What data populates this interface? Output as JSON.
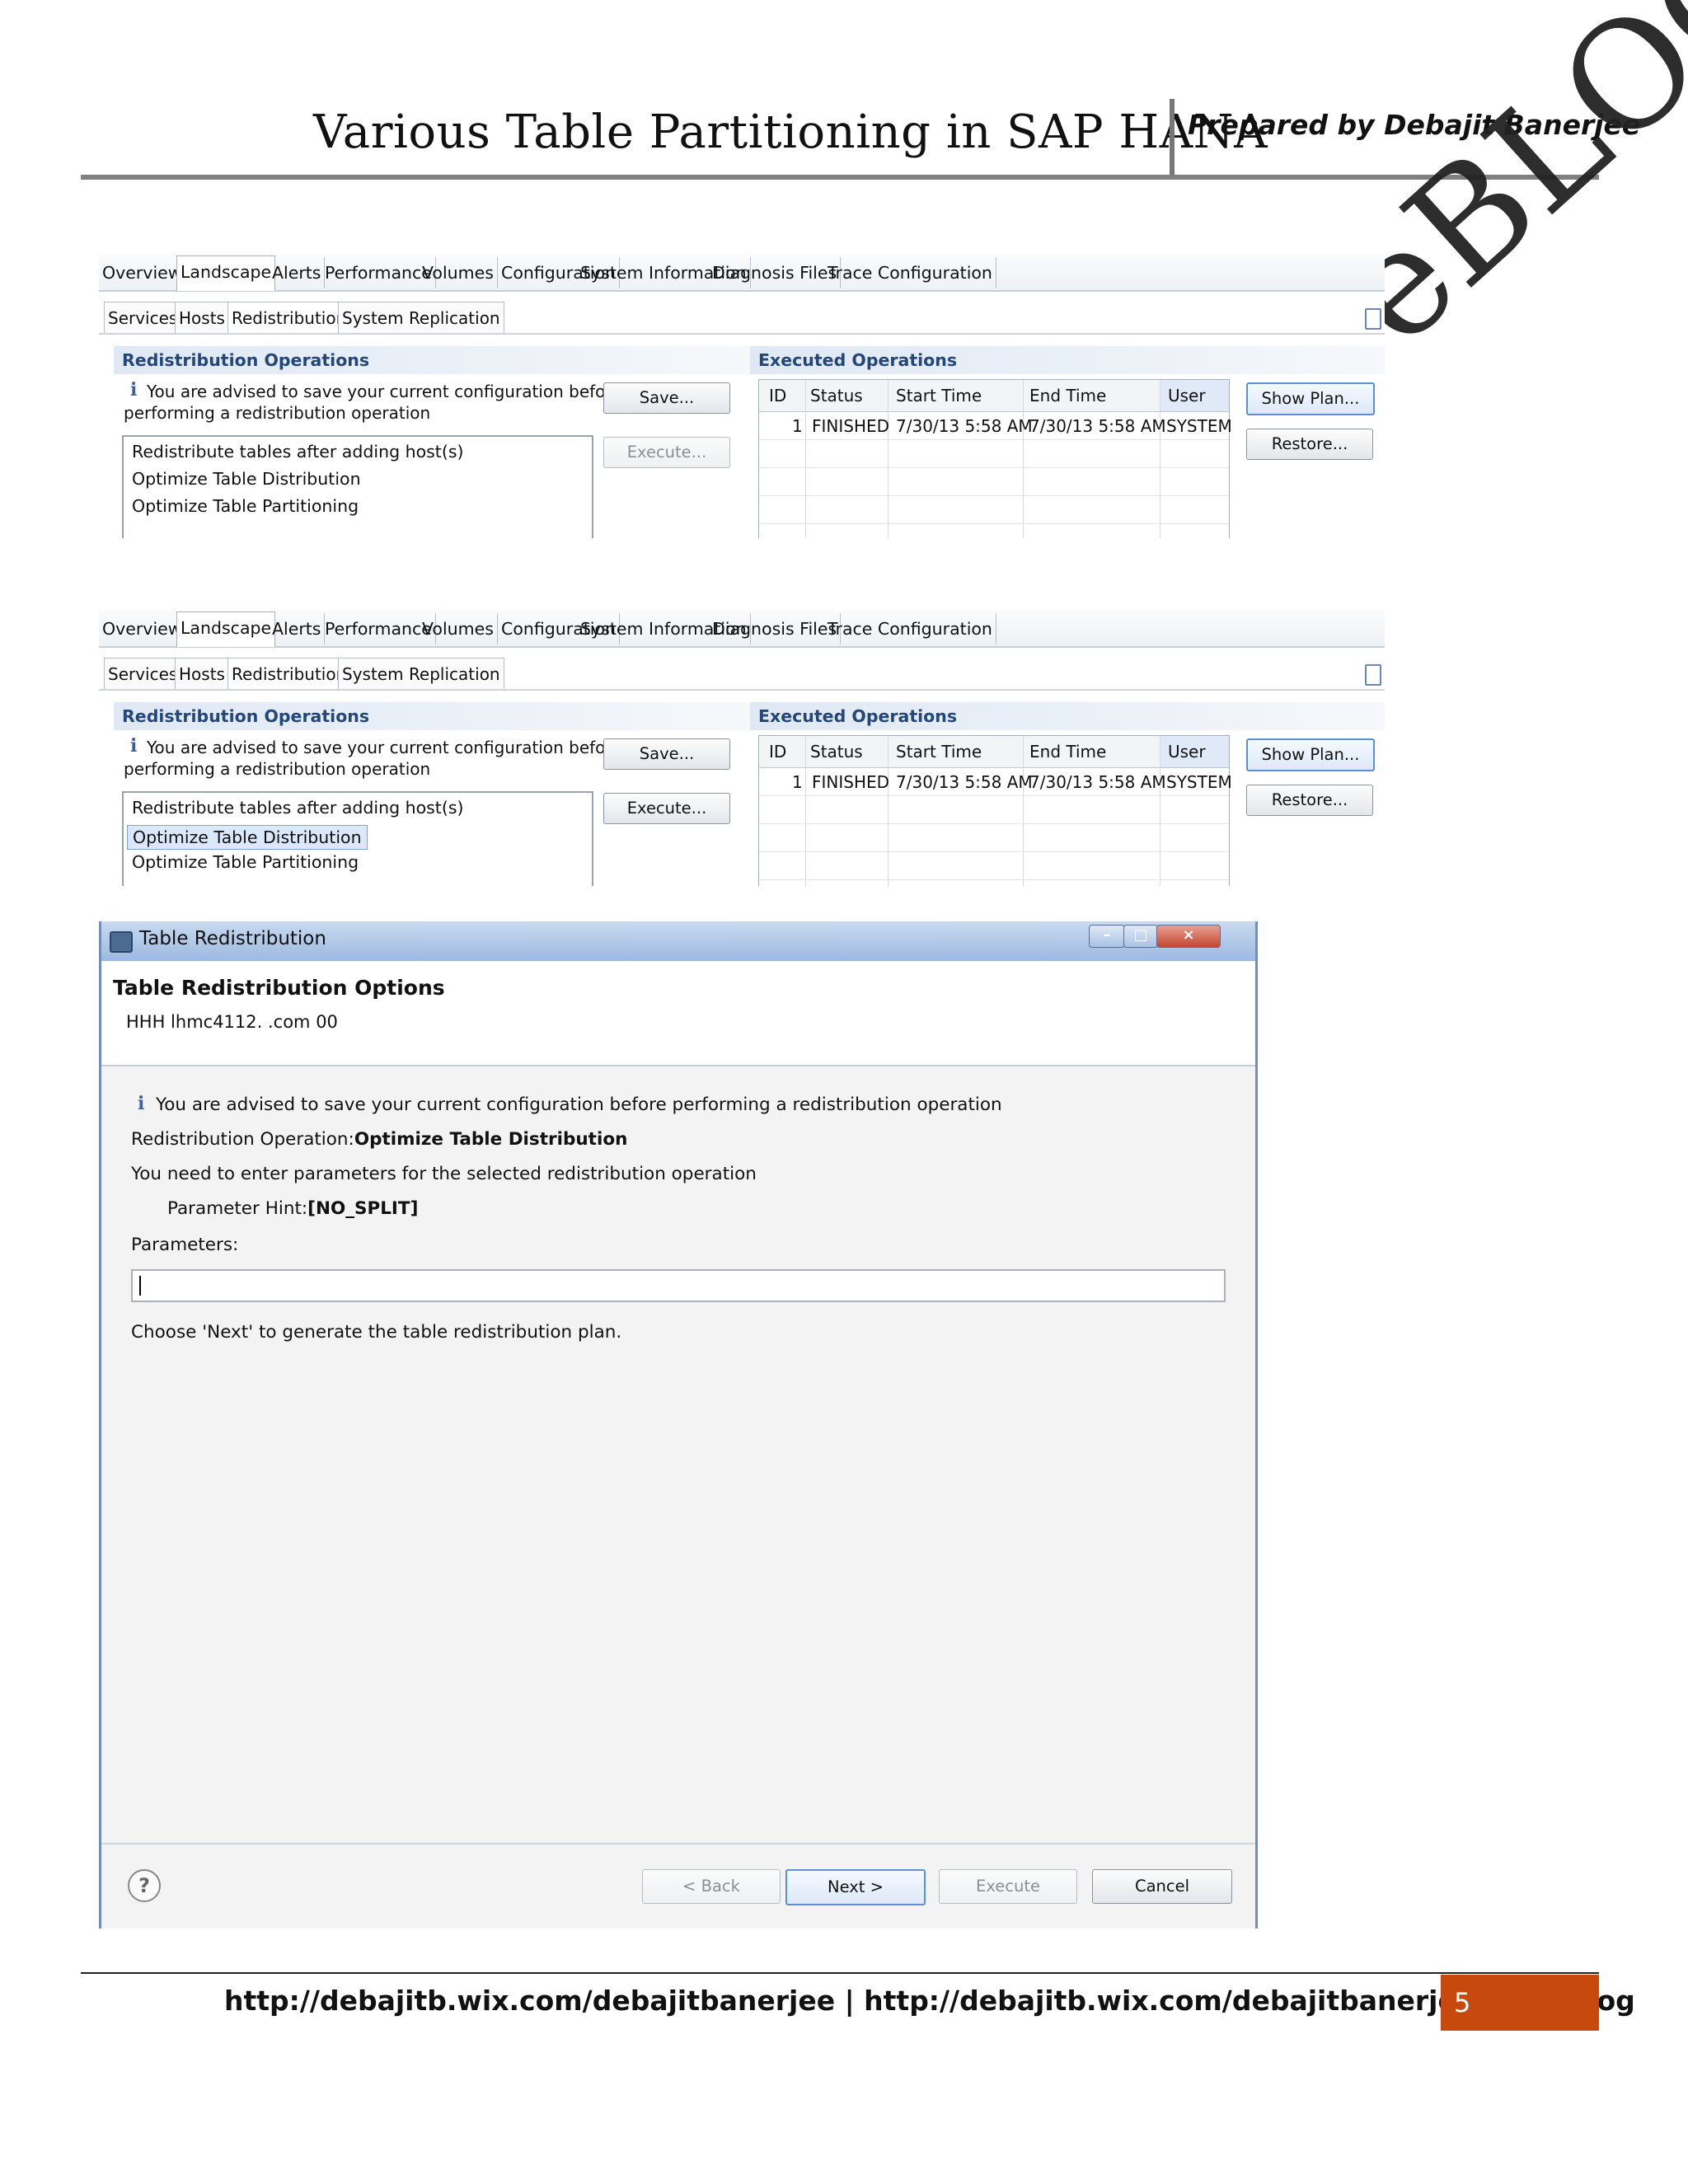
{
  "document": {
    "title": "Various Table Partitioning in SAP HANA",
    "author": "Prepared by Debajit Banerjee",
    "watermark": "DeBLOG",
    "footer_links": "http://debajitb.wix.com/debajitbanerjee | http://debajitb.wix.com/debajitbanerjee/apps/blog",
    "page_number": "5"
  },
  "studio": {
    "main_tabs": [
      "Overview",
      "Landscape",
      "Alerts",
      "Performance",
      "Volumes",
      "Configuration",
      "System Information",
      "Diagnosis Files",
      "Trace Configuration"
    ],
    "active_main_tab": "Landscape",
    "sub_tabs": [
      "Services",
      "Hosts",
      "Redistribution",
      "System Replication"
    ],
    "active_sub_tab": "Redistribution",
    "redistribution_title": "Redistribution Operations",
    "advice_line1": "You are advised to save your current configuration before",
    "advice_line2": "performing a redistribution operation",
    "operations": [
      "Redistribute tables after adding host(s)",
      "Optimize Table Distribution",
      "Optimize Table Partitioning"
    ],
    "save_label": "Save...",
    "execute_label": "Execute...",
    "executed_title": "Executed Operations",
    "columns": [
      "ID",
      "Status",
      "Start Time",
      "End Time",
      "User"
    ],
    "rows": [
      {
        "id": "1",
        "status": "FINISHED",
        "start": "7/30/13 5:58 AM",
        "end": "7/30/13 5:58 AM",
        "user": "SYSTEM"
      }
    ],
    "show_plan_label": "Show Plan...",
    "restore_label": "Restore..."
  },
  "panel1": {
    "execute_enabled": false,
    "selected_operation": ""
  },
  "panel2": {
    "execute_enabled": true,
    "selected_operation": "Optimize Table Distribution"
  },
  "dialog": {
    "window_title": "Table Redistribution",
    "heading": "Table Redistribution Options",
    "system": "HHH lhmc4112.         .com 00",
    "advice": "You are advised to save your current configuration before performing a redistribution operation",
    "operation_label": "Redistribution Operation:",
    "operation_value": "Optimize Table Distribution",
    "params_instruction": "You need to enter parameters for the selected redistribution operation",
    "hint_label": "Parameter Hint:",
    "hint_value": "[NO_SPLIT]",
    "parameters_label": "Parameters:",
    "parameters_value": "",
    "next_instruction": "Choose 'Next' to generate the table redistribution plan.",
    "back_label": "< Back",
    "next_label": "Next >",
    "execute_label": "Execute",
    "cancel_label": "Cancel",
    "help_glyph": "?"
  },
  "colors": {
    "accent": "#24477a",
    "page_box": "#c8490d",
    "titlebar": "#9cb9e0"
  }
}
